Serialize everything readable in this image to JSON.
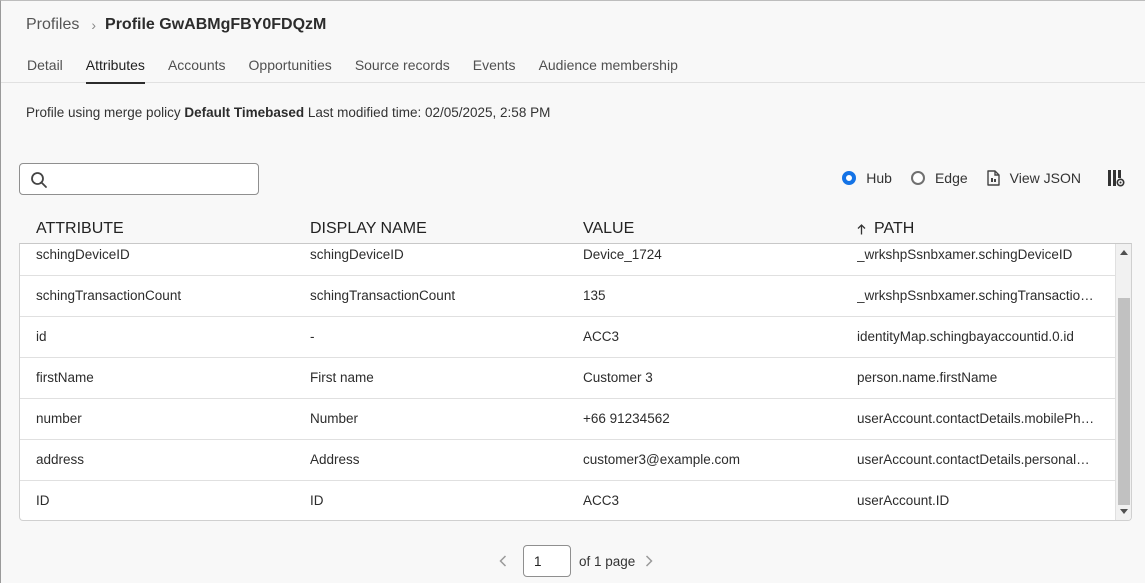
{
  "breadcrumb": {
    "parent": "Profiles",
    "separator": "›",
    "current": "Profile GwABMgFBY0FDQzM"
  },
  "tabs": [
    {
      "label": "Detail",
      "active": false
    },
    {
      "label": "Attributes",
      "active": true
    },
    {
      "label": "Accounts",
      "active": false
    },
    {
      "label": "Opportunities",
      "active": false
    },
    {
      "label": "Source records",
      "active": false
    },
    {
      "label": "Events",
      "active": false
    },
    {
      "label": "Audience membership",
      "active": false
    }
  ],
  "merge_info": {
    "prefix": "Profile using merge policy",
    "policy": "Default Timebased",
    "modified_label": "Last modified time:",
    "modified_value": "02/05/2025, 2:58 PM"
  },
  "search": {
    "value": "",
    "placeholder": ""
  },
  "toolbar": {
    "hub_label": "Hub",
    "edge_label": "Edge",
    "selected": "Hub",
    "view_json_label": "View JSON"
  },
  "table": {
    "headers": {
      "attribute": "ATTRIBUTE",
      "display_name": "DISPLAY NAME",
      "value": "VALUE",
      "path": "PATH"
    },
    "sort_column": "PATH",
    "rows": [
      {
        "attribute": "schingDeviceID",
        "display_name": "schingDeviceID",
        "value": "Device_1724",
        "path": "_wrkshpSsnbxamer.schingDeviceID"
      },
      {
        "attribute": "schingTransactionCount",
        "display_name": "schingTransactionCount",
        "value": "135",
        "path": "_wrkshpSsnbxamer.schingTransactionC..."
      },
      {
        "attribute": "id",
        "display_name": "-",
        "value": "ACC3",
        "path": "identityMap.schingbayaccountid.0.id"
      },
      {
        "attribute": "firstName",
        "display_name": "First name",
        "value": "Customer 3",
        "path": "person.name.firstName"
      },
      {
        "attribute": "number",
        "display_name": "Number",
        "value": "+66 91234562",
        "path": "userAccount.contactDetails.mobilePhon..."
      },
      {
        "attribute": "address",
        "display_name": "Address",
        "value": "customer3@example.com",
        "path": "userAccount.contactDetails.personalEm..."
      },
      {
        "attribute": "ID",
        "display_name": "ID",
        "value": "ACC3",
        "path": "userAccount.ID"
      }
    ]
  },
  "pagination": {
    "current_page": "1",
    "of_label": "of 1 page"
  },
  "colors": {
    "accent": "#1473e6",
    "background": "#f8f8f8",
    "text": "#2c2c2c"
  }
}
